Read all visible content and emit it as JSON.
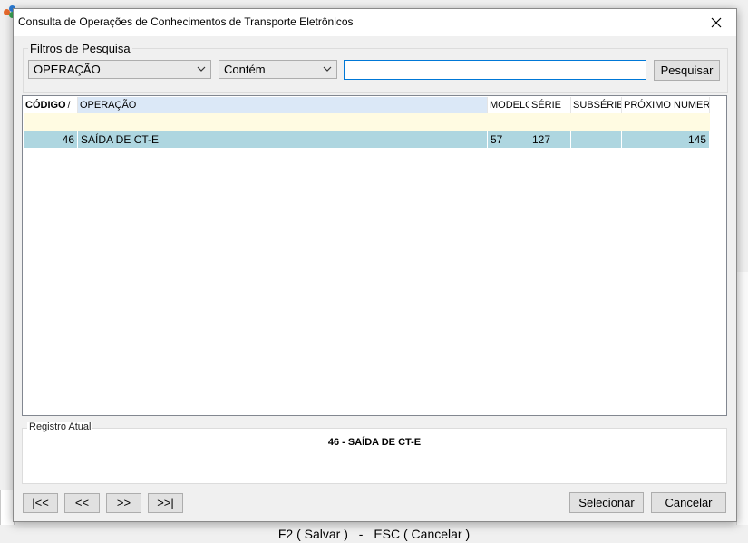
{
  "background": {
    "footer": {
      "save_hint": "F2 ( Salvar )",
      "separator": "-",
      "cancel_hint": "ESC ( Cancelar )"
    }
  },
  "dialog": {
    "title": "Consulta de Operações de Conhecimentos de Transporte Eletrônicos",
    "filters": {
      "legend": "Filtros de Pesquisa",
      "field_select": "OPERAÇÃO",
      "condition_select": "Contém",
      "search_value": "",
      "search_button": "Pesquisar"
    },
    "grid": {
      "columns": [
        "CÓDIGO",
        "OPERAÇÃO",
        "MODELO",
        "SÉRIE",
        "SUBSÉRIE",
        "PRÓXIMO NUMERO"
      ],
      "sort_marker": "/",
      "rows": [
        {
          "codigo": "46",
          "operacao": "SAÍDA DE CT-E",
          "modelo": "57",
          "serie": "127",
          "subserie": "",
          "proximo_numero": "145"
        }
      ]
    },
    "current_record": {
      "legend": "Registro Atual",
      "value": "46 - SAÍDA DE CT-E"
    },
    "navigation": {
      "first": "|<<",
      "prev": "<<",
      "next": ">>",
      "last": ">>|"
    },
    "actions": {
      "select": "Selecionar",
      "cancel": "Cancelar"
    }
  },
  "colors": {
    "selected_row": "#aed6e0",
    "new_row": "#fffbe2",
    "selected_header": "#dbe8f7",
    "focus_border": "#0078d7"
  }
}
